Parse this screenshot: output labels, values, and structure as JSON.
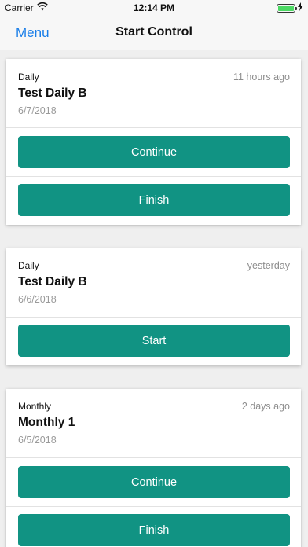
{
  "status_bar": {
    "carrier": "Carrier",
    "time": "12:14 PM"
  },
  "nav": {
    "menu_label": "Menu",
    "title": "Start Control"
  },
  "controls": [
    {
      "type": "Daily",
      "ago": "11 hours ago",
      "name": "Test Daily B",
      "date": "6/7/2018",
      "buttons": [
        "Continue",
        "Finish"
      ]
    },
    {
      "type": "Daily",
      "ago": "yesterday",
      "name": "Test Daily B",
      "date": "6/6/2018",
      "buttons": [
        "Start"
      ]
    },
    {
      "type": "Monthly",
      "ago": "2 days ago",
      "name": "Monthly 1",
      "date": "6/5/2018",
      "buttons": [
        "Continue",
        "Finish"
      ]
    }
  ],
  "colors": {
    "accent": "#119383",
    "link": "#1a7ee8"
  }
}
